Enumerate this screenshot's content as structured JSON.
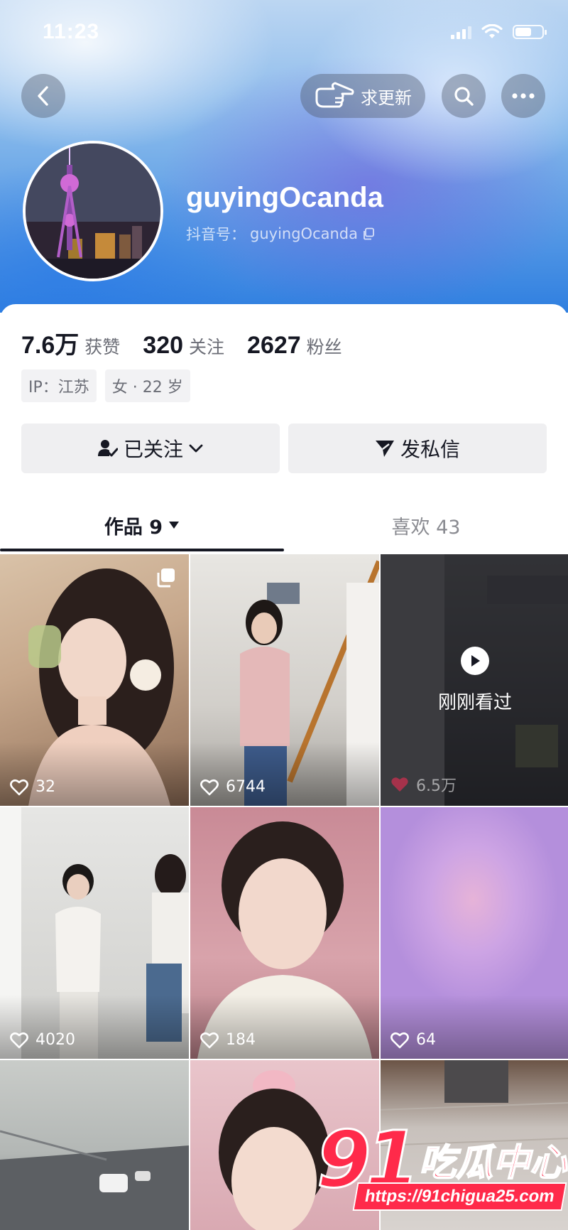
{
  "status_bar": {
    "time": "11:23"
  },
  "header": {
    "update_button_label": "求更新",
    "username": "guyingOcanda",
    "douyin_id_label": "抖音号：",
    "douyin_id": "guyingOcanda"
  },
  "stats": [
    {
      "value": "7.6万",
      "label": "获赞"
    },
    {
      "value": "320",
      "label": "关注"
    },
    {
      "value": "2627",
      "label": "粉丝"
    }
  ],
  "tags": [
    "IP：江苏",
    "女 · 22 岁"
  ],
  "actions": {
    "follow_label": "已关注",
    "message_label": "发私信"
  },
  "tabs": [
    {
      "label": "作品 9",
      "active": true
    },
    {
      "label": "喜欢 43",
      "active": false
    }
  ],
  "videos": [
    {
      "likes": "32"
    },
    {
      "likes": "6744"
    },
    {
      "likes": "6.5万",
      "watched_label": "刚刚看过"
    },
    {
      "likes": "4020"
    },
    {
      "likes": "184"
    },
    {
      "likes": "64"
    },
    {
      "likes": ""
    },
    {
      "likes": ""
    },
    {
      "likes": ""
    }
  ],
  "watermark": {
    "brand_number": "91",
    "brand_text": "吃瓜中心",
    "url": "https://91chigua25.com"
  },
  "colors": {
    "accent": "#fe2c55",
    "text_primary": "#161823",
    "text_secondary": "#6b6d76"
  }
}
